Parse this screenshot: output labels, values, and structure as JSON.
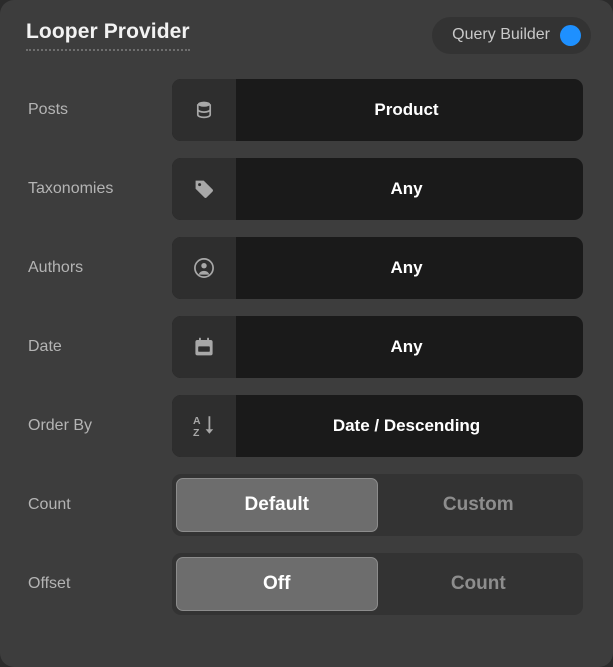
{
  "header": {
    "title": "Looper Provider",
    "query_builder_label": "Query Builder",
    "toggle_icon": "toggle-on-dot",
    "accent_color": "#1e90ff"
  },
  "theme": {
    "panel_bg": "#3d3d3d",
    "field_bg": "#1a1a1a",
    "icon_bg": "#2e2e2e",
    "segment_track_bg": "#333333",
    "segment_selected_bg": "#6d6d6d",
    "label_color": "#b4b4b4",
    "value_color": "#ffffff"
  },
  "rows": [
    {
      "label": "Posts",
      "type": "select",
      "icon": "database-icon",
      "value": "Product"
    },
    {
      "label": "Taxonomies",
      "type": "select",
      "icon": "tag-icon",
      "value": "Any"
    },
    {
      "label": "Authors",
      "type": "select",
      "icon": "account-circle-icon",
      "value": "Any"
    },
    {
      "label": "Date",
      "type": "select",
      "icon": "calendar-icon",
      "value": "Any"
    },
    {
      "label": "Order By",
      "type": "select",
      "icon": "sort-az-descending-icon",
      "value": "Date / Descending"
    },
    {
      "label": "Count",
      "type": "segmented",
      "options": [
        "Default",
        "Custom"
      ],
      "selected": "Default"
    },
    {
      "label": "Offset",
      "type": "segmented",
      "options": [
        "Off",
        "Count"
      ],
      "selected": "Off"
    }
  ]
}
